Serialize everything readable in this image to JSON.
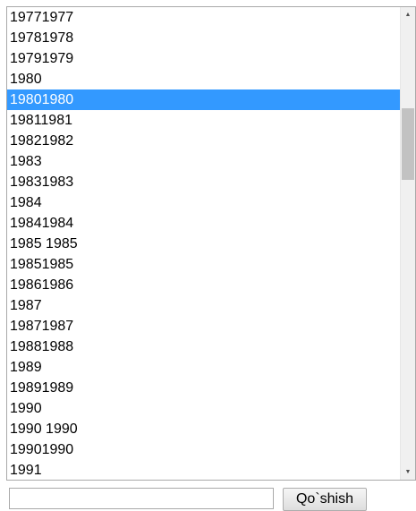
{
  "listbox": {
    "items": [
      "19771977",
      "19781978",
      "19791979",
      "1980",
      "19801980",
      "19811981",
      "19821982",
      "1983",
      "19831983",
      "1984",
      "19841984",
      "1985 1985",
      "19851985",
      "19861986",
      "1987",
      "19871987",
      "19881988",
      "1989",
      "19891989",
      "1990",
      "1990 1990",
      "19901990",
      "1991"
    ],
    "selected_index": 4,
    "colors": {
      "selection_background": "#3399ff",
      "selection_text": "#ffffff"
    }
  },
  "scrollbar": {
    "up_icon": "scroll-up-arrow-icon",
    "down_icon": "scroll-down-arrow-icon"
  },
  "form": {
    "input_value": "",
    "submit_label": "Qo`shish"
  }
}
